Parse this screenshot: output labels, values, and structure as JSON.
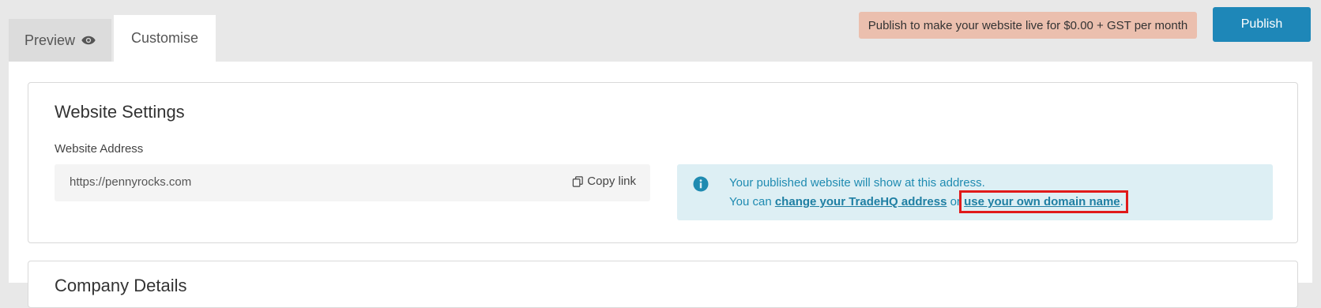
{
  "tabs": {
    "preview_label": "Preview",
    "customise_label": "Customise"
  },
  "header": {
    "publish_notice": "Publish to make your website live for $0.00 + GST per month",
    "publish_label": "Publish"
  },
  "website_settings": {
    "title": "Website Settings",
    "address_label": "Website Address",
    "address_value": "https://pennyrocks.com",
    "copy_label": "Copy link",
    "info": {
      "line1": "Your published website will show at this address.",
      "line2_prefix": "You can ",
      "link1": "change your TradeHQ address",
      "line2_mid": " or ",
      "link2": "use your own domain name",
      "line2_suffix": "."
    }
  },
  "next_section": {
    "title": "Company Details"
  },
  "colors": {
    "accent": "#1e87b8",
    "notice_bg": "#ebbfae",
    "info_bg": "#ddeff4",
    "highlight": "#e01a1a"
  }
}
